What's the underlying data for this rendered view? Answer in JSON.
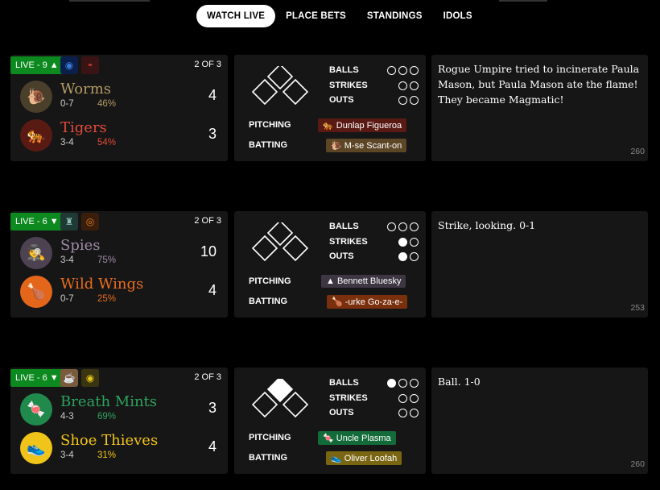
{
  "nav": {
    "items": [
      {
        "label": "WATCH LIVE",
        "active": true
      },
      {
        "label": "PLACE BETS",
        "active": false
      },
      {
        "label": "STANDINGS",
        "active": false
      },
      {
        "label": "IDOLS",
        "active": false
      }
    ]
  },
  "games": [
    {
      "live_label": "LIVE - 9 ▲",
      "weather_icons": [
        "blue-swirl-icon",
        "red-bowl-icon"
      ],
      "series": "2 OF 3",
      "away": {
        "name": "Worms",
        "emoji": "🐌",
        "record": "0-7",
        "pct": "46%",
        "score": "4",
        "color": "#b59a64",
        "bg": "#4a3f2a"
      },
      "home": {
        "name": "Tigers",
        "emoji": "🐅",
        "record": "3-4",
        "pct": "54%",
        "score": "3",
        "color": "#e04a3a",
        "bg": "#5a1a14"
      },
      "balls": [
        false,
        false,
        false
      ],
      "strikes": [
        false,
        false
      ],
      "outs": [
        false,
        false
      ],
      "bases_occupied": [
        false,
        false,
        false
      ],
      "labels": {
        "balls": "BALLS",
        "strikes": "STRIKES",
        "outs": "OUTS",
        "pitching": "PITCHING",
        "batting": "BATTING"
      },
      "pitcher": {
        "emoji": "🐅",
        "name": "Dunlap Figueroa",
        "bg": "#5a1a14"
      },
      "batter": {
        "emoji": "🐌",
        "name": "M-se Scant-on",
        "bg": "#5c4626"
      },
      "log": "Rogue Umpire tried to incinerate Paula Mason, but Paula Mason ate the flame! They became Magmatic!",
      "log_num": "260"
    },
    {
      "live_label": "LIVE - 6 ▼",
      "weather_icons": [
        "green-figure-icon",
        "orange-ring-icon"
      ],
      "series": "2 OF 3",
      "away": {
        "name": "Spies",
        "emoji": "🕵",
        "record": "3-4",
        "pct": "75%",
        "score": "10",
        "color": "#a08aa8",
        "bg": "#4d4252"
      },
      "home": {
        "name": "Wild Wings",
        "emoji": "🍗",
        "record": "0-7",
        "pct": "25%",
        "score": "4",
        "color": "#e76c1e",
        "bg": "#e4661a"
      },
      "balls": [
        false,
        false,
        false
      ],
      "strikes": [
        true,
        false
      ],
      "outs": [
        true,
        false
      ],
      "bases_occupied": [
        false,
        false,
        false
      ],
      "labels": {
        "balls": "BALLS",
        "strikes": "STRIKES",
        "outs": "OUTS",
        "pitching": "PITCHING",
        "batting": "BATTING"
      },
      "pitcher": {
        "emoji": "▲",
        "name": "Bennett Bluesky",
        "bg": "#3e3642"
      },
      "batter": {
        "emoji": "🍗",
        "name": "-urke Go-za-e-",
        "bg": "#7a300c"
      },
      "log": "Strike, looking. 0-1",
      "log_num": "253"
    },
    {
      "live_label": "LIVE - 6 ▼",
      "weather_icons": [
        "coffee-cup-icon",
        "yellow-coin-icon"
      ],
      "series": "2 OF 3",
      "away": {
        "name": "Breath Mints",
        "emoji": "🍬",
        "record": "4-3",
        "pct": "69%",
        "score": "3",
        "color": "#2ea35e",
        "bg": "#1f8a4c"
      },
      "home": {
        "name": "Shoe Thieves",
        "emoji": "👟",
        "record": "3-4",
        "pct": "31%",
        "score": "4",
        "color": "#f0c419",
        "bg": "#f0c419"
      },
      "balls": [
        true,
        false,
        false
      ],
      "strikes": [
        false,
        false
      ],
      "outs": [
        false,
        false
      ],
      "bases_occupied": [
        false,
        true,
        false
      ],
      "labels": {
        "balls": "BALLS",
        "strikes": "STRIKES",
        "outs": "OUTS",
        "pitching": "PITCHING",
        "batting": "BATTING"
      },
      "pitcher": {
        "emoji": "🍬",
        "name": "Uncle Plasma",
        "bg": "#146b3a"
      },
      "batter": {
        "emoji": "👟",
        "name": "Oliver Loofah",
        "bg": "#7a6512"
      },
      "log": "Ball. 1-0",
      "log_num": "260"
    }
  ]
}
